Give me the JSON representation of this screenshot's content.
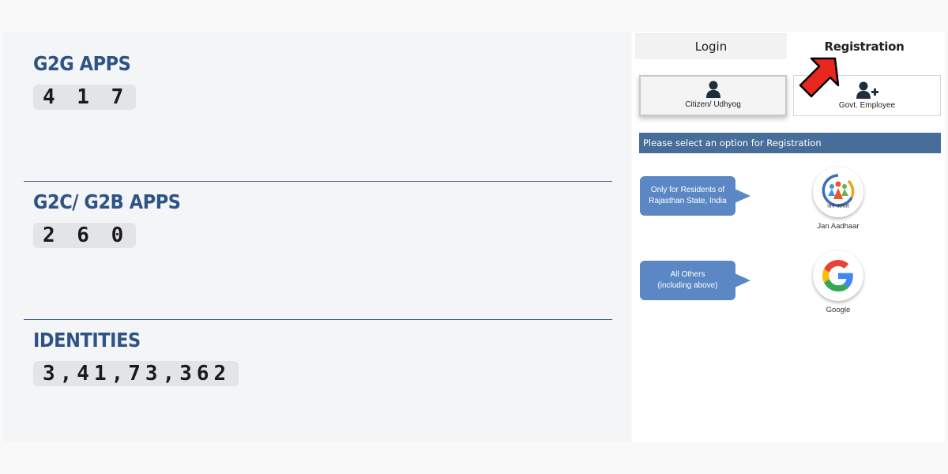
{
  "stats": {
    "g2g": {
      "title": "G2G APPS",
      "value": "4 1 7"
    },
    "g2c": {
      "title": "G2C/ G2B APPS",
      "value": "2 6 0"
    },
    "identities": {
      "title": "IDENTITIES",
      "value": "3,41,73,362"
    }
  },
  "tabs": {
    "login": "Login",
    "registration": "Registration"
  },
  "options": {
    "citizen": {
      "label": "Citizen/ Udhyog",
      "icon": "user-icon"
    },
    "employee": {
      "label": "Govt. Employee",
      "icon": "user-plus-icon"
    }
  },
  "info_bar": "Please select an option for Registration",
  "providers": {
    "jan_aadhaar": {
      "bubble_line1": "Only for Residents of",
      "bubble_line2": "Rajasthan State, India",
      "logo_text": "जन-आधार",
      "label": "Jan Aadhaar"
    },
    "google": {
      "bubble_line1": "All Others",
      "bubble_line2": "(including above)",
      "label": "Google"
    }
  },
  "colors": {
    "heading": "#2e5387",
    "info_bar": "#476d99",
    "bubble": "#5b88c5",
    "arrow": "#e8271e"
  }
}
